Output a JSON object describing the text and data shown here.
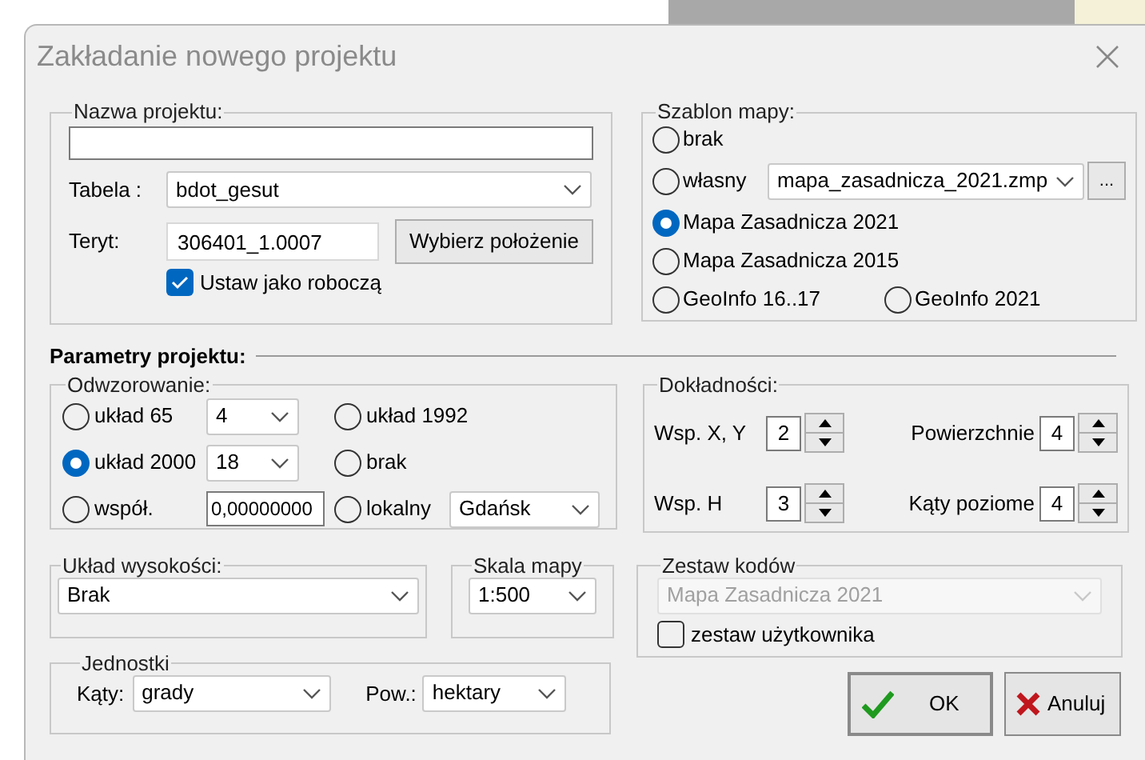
{
  "window": {
    "title": "Zakładanie nowego projektu"
  },
  "project": {
    "title": "Nazwa projektu:",
    "table_label": "Tabela :",
    "table_value": "bdot_gesut",
    "teryt_label": "Teryt:",
    "teryt_value": "306401_1.0007",
    "locate_button": "Wybierz położenie",
    "working": {
      "label": "Ustaw jako roboczą",
      "checked": true
    }
  },
  "map_template": {
    "title": "Szablon mapy:",
    "file_value": "mapa_zasadnicza_2021.zmp",
    "browse_button": "...",
    "options": [
      {
        "label": "brak",
        "selected": false
      },
      {
        "label": "własny",
        "selected": false
      },
      {
        "label": "Mapa Zasadnicza 2021",
        "selected": true
      },
      {
        "label": "Mapa Zasadnicza 2015",
        "selected": false
      },
      {
        "label": "GeoInfo 16..17",
        "selected": false
      },
      {
        "label": "GeoInfo 2021",
        "selected": false
      }
    ]
  },
  "parameters": {
    "heading": "Parametry projektu:"
  },
  "projection": {
    "title": "Odwzorowanie:",
    "options": [
      {
        "label": "układ 65",
        "selected": false,
        "kind": "dropdown",
        "field_value": "4"
      },
      {
        "label": "układ 1992",
        "selected": false,
        "kind": "plain"
      },
      {
        "label": "układ 2000",
        "selected": true,
        "kind": "dropdown",
        "field_value": "18"
      },
      {
        "label": "brak",
        "selected": false,
        "kind": "plain"
      },
      {
        "label": "współ.",
        "selected": false,
        "kind": "input",
        "field_value": "0,00000000"
      },
      {
        "label": "lokalny",
        "selected": false,
        "kind": "dropdown",
        "field_value": "Gdańsk"
      }
    ]
  },
  "accuracy": {
    "title": "Dokładności:",
    "fields": [
      {
        "label": "Wsp. X, Y",
        "value": "2"
      },
      {
        "label": "Powierzchnie",
        "value": "4"
      },
      {
        "label": "Wsp. H",
        "value": "3"
      },
      {
        "label": "Kąty poziome",
        "value": "4"
      }
    ]
  },
  "height_system": {
    "title": "Układ wysokości:",
    "value": "Brak"
  },
  "map_scale": {
    "title": "Skala mapy",
    "value": "1:500"
  },
  "code_set": {
    "title": "Zestaw kodów",
    "value": "Mapa Zasadnicza 2021",
    "disabled": true,
    "user_set": {
      "label": "zestaw użytkownika",
      "checked": false
    }
  },
  "units": {
    "title": "Jednostki",
    "angles_label": "Kąty:",
    "angles_value": "grady",
    "area_label": "Pow.:",
    "area_value": "hektary"
  },
  "buttons": [
    {
      "label": "OK",
      "kind": "ok"
    },
    {
      "label": "Anuluj",
      "kind": "cancel"
    }
  ]
}
